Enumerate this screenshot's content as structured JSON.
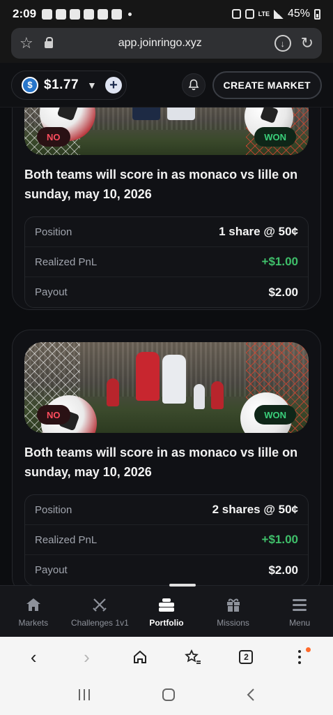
{
  "status_bar": {
    "time": "2:09",
    "battery": "45%",
    "network": "LTE"
  },
  "browser": {
    "url": "app.joinringo.xyz",
    "tab_count": "2"
  },
  "header": {
    "balance": "$1.77",
    "create_market_label": "CREATE MARKET"
  },
  "cards": [
    {
      "title": "Both teams will score in as monaco vs lille on sunday, may 10, 2026",
      "left_badge": "NO",
      "right_badge": "WON",
      "rows": [
        {
          "label": "Position",
          "value": "1 share @ 50¢"
        },
        {
          "label": "Realized PnL",
          "value": "+$1.00"
        },
        {
          "label": "Payout",
          "value": "$2.00"
        }
      ]
    },
    {
      "title": "Both teams will score in as monaco vs lille on sunday, may 10, 2026",
      "left_badge": "NO",
      "right_badge": "WON",
      "rows": [
        {
          "label": "Position",
          "value": "2 shares @ 50¢"
        },
        {
          "label": "Realized PnL",
          "value": "+$1.00"
        },
        {
          "label": "Payout",
          "value": "$2.00"
        }
      ]
    }
  ],
  "bottom_nav": {
    "items": [
      {
        "label": "Markets",
        "icon": "home-icon"
      },
      {
        "label": "Challenges 1v1",
        "icon": "crossed-swords-icon"
      },
      {
        "label": "Portfolio",
        "icon": "briefcase-icon"
      },
      {
        "label": "Missions",
        "icon": "gift-icon"
      },
      {
        "label": "Menu",
        "icon": "hamburger-icon"
      }
    ],
    "active": "Portfolio"
  },
  "colors": {
    "positive": "#3fbf6a",
    "no_badge": "#ff4d5e",
    "won_badge": "#3ad07a",
    "usdc": "#2775ca"
  }
}
